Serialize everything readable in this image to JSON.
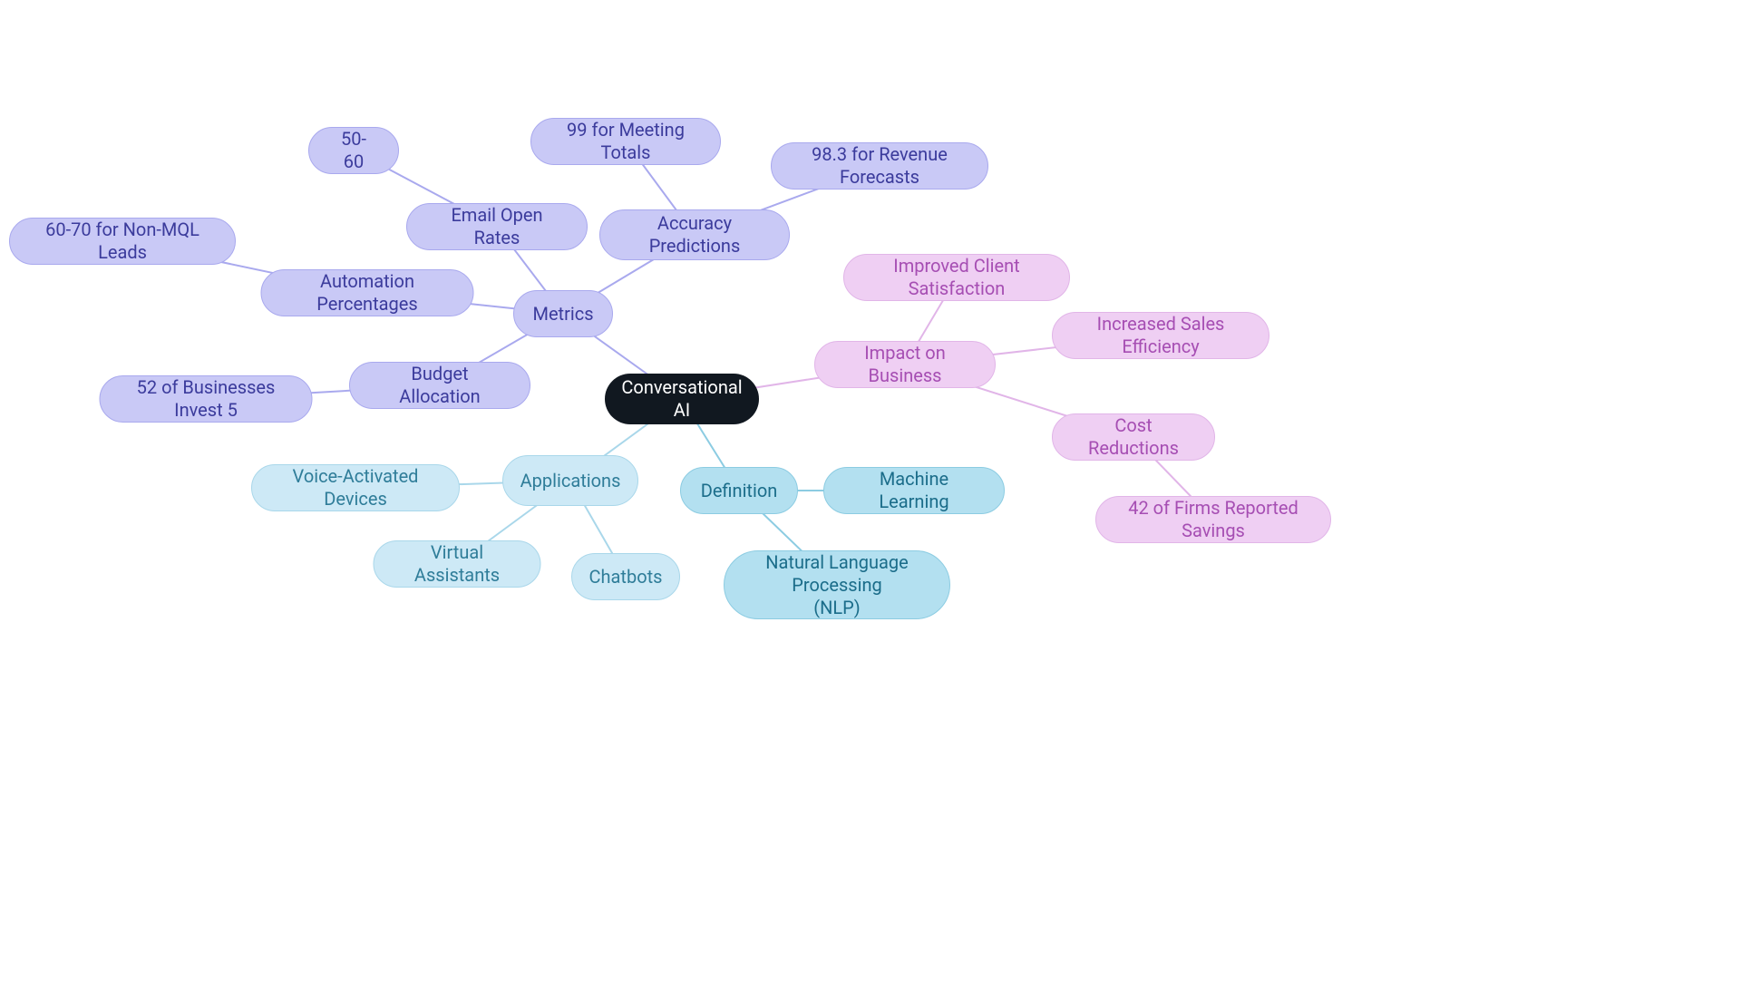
{
  "root": "Conversational AI",
  "definition": {
    "label": "Definition",
    "ml": "Machine Learning",
    "nlp": "Natural Language Processing\n(NLP)"
  },
  "applications": {
    "label": "Applications",
    "voice": "Voice-Activated Devices",
    "virtual": "Virtual Assistants",
    "chatbots": "Chatbots"
  },
  "metrics": {
    "label": "Metrics",
    "budget": {
      "label": "Budget Allocation",
      "stat": "52 of Businesses Invest 5"
    },
    "automation": {
      "label": "Automation Percentages",
      "stat": "60-70 for Non-MQL Leads"
    },
    "email": {
      "label": "Email Open Rates",
      "stat": "50-60"
    },
    "accuracy": {
      "label": "Accuracy Predictions",
      "meeting": "99 for Meeting Totals",
      "revenue": "98.3 for Revenue Forecasts"
    }
  },
  "impact": {
    "label": "Impact on Business",
    "client": "Improved Client Satisfaction",
    "sales": "Increased Sales Efficiency",
    "cost": {
      "label": "Cost Reductions",
      "stat": "42 of Firms Reported Savings"
    }
  },
  "colors": {
    "edge_blue": "#8ccce2",
    "edge_lightblue": "#a9d7ea",
    "edge_purple": "#a9a9ee",
    "edge_pink": "#e1b5e8"
  }
}
